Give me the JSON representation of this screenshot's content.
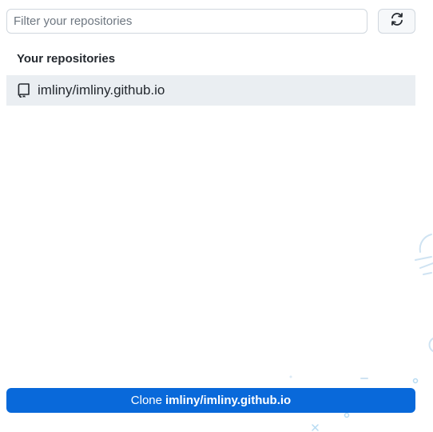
{
  "filter": {
    "placeholder": "Filter your repositories",
    "value": ""
  },
  "refresh_button": {
    "icon": "sync-icon"
  },
  "repositories": {
    "heading": "Your repositories",
    "items": [
      {
        "name": "imliny/imliny.github.io",
        "icon": "repo-icon",
        "selected": true
      }
    ]
  },
  "clone_button": {
    "prefix": "Clone",
    "repo": "imliny/imliny.github.io"
  },
  "colors": {
    "accent": "#0969da",
    "selected_row": "#eaeef2",
    "border": "#d0d7de",
    "decoration": "#b6dbf2"
  }
}
